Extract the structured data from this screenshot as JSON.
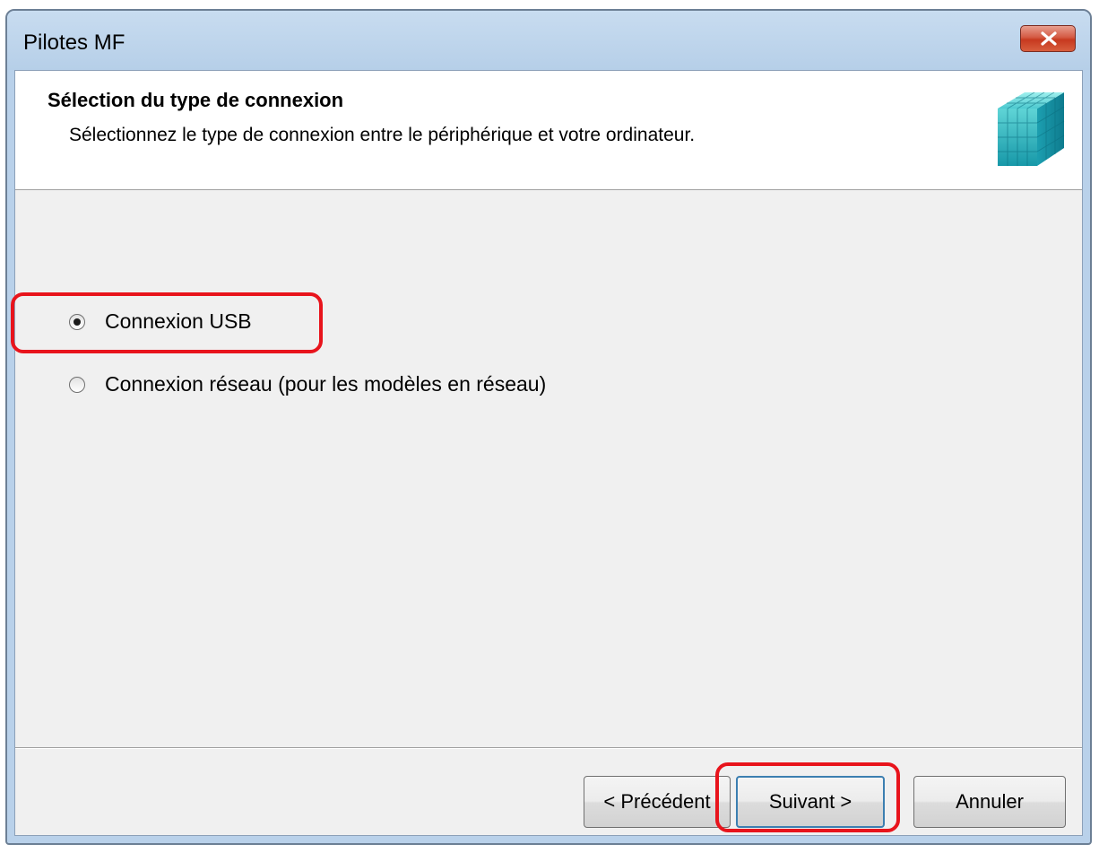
{
  "window": {
    "title": "Pilotes MF"
  },
  "header": {
    "heading": "Sélection du type de connexion",
    "subheading": "Sélectionnez le type de connexion entre le périphérique et votre ordinateur."
  },
  "options": [
    {
      "label": "Connexion USB",
      "checked": true
    },
    {
      "label": "Connexion réseau (pour les modèles en réseau)",
      "checked": false
    }
  ],
  "buttons": {
    "previous": "< Précédent",
    "next": "Suivant >",
    "cancel": "Annuler"
  },
  "colors": {
    "highlight": "#e8141c",
    "close_button": "#c7391f",
    "logo": "#2ab8c0"
  },
  "icons": {
    "close": "close-icon",
    "logo": "cube-logo-icon"
  }
}
